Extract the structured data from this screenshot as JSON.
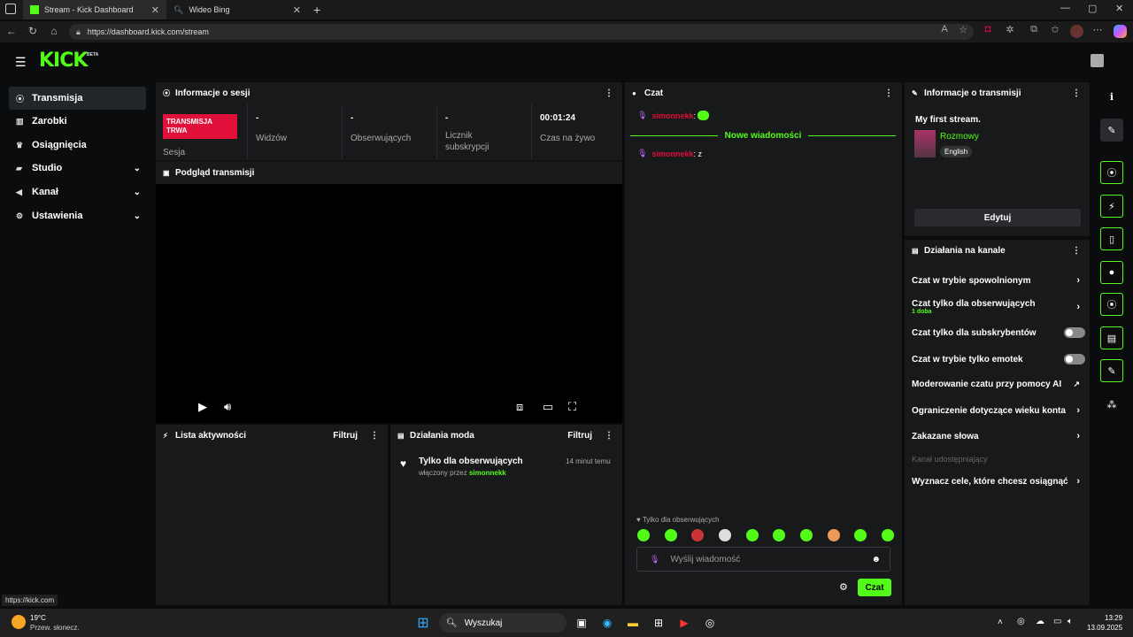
{
  "browser": {
    "tabs": [
      {
        "title": "Stream - Kick Dashboard"
      },
      {
        "title": "Wideo Bing"
      }
    ],
    "url": "https://dashboard.kick.com/stream",
    "status_url": "https://kick.com"
  },
  "app": {
    "logo": "KICK",
    "badge": "BETA"
  },
  "sidebar": {
    "items": [
      {
        "label": "Transmisja"
      },
      {
        "label": "Zarobki"
      },
      {
        "label": "Osiągnięcia"
      },
      {
        "label": "Studio"
      },
      {
        "label": "Kanał"
      },
      {
        "label": "Ustawienia"
      }
    ]
  },
  "session": {
    "title": "Informacje o sesji",
    "live_badge": "TRANSMISJA TRWA",
    "live_label": "Sesja",
    "stats": [
      {
        "value": "-",
        "label": "Widzów"
      },
      {
        "value": "-",
        "label": "Obserwujących"
      },
      {
        "value": "-",
        "label": "Licznik subskrypcji"
      },
      {
        "value": "00:01:24",
        "label": "Czas na żywo"
      }
    ]
  },
  "preview": {
    "title": "Podgląd transmisji"
  },
  "activity": {
    "title": "Lista aktywności",
    "filter": "Filtruj"
  },
  "mod": {
    "title": "Działania moda",
    "filter": "Filtruj",
    "entry": {
      "title": "Tylko dla obserwujących",
      "by_prefix": "włączony przez",
      "by_user": "simonnekk",
      "time": "14 minut temu"
    }
  },
  "chat": {
    "title": "Czat",
    "messages": [
      {
        "user": "simonnekk",
        "text": ""
      },
      {
        "user": "simonnekk",
        "text": "z"
      }
    ],
    "new_messages": "Nowe wiadomości",
    "mode_note": "Tylko dla obserwujących",
    "input_placeholder": "Wyślij wiadomość",
    "send_label": "Czat"
  },
  "stream_info": {
    "title": "Informacje o transmisji",
    "stream_title": "My first stream.",
    "category": "Rozmowy",
    "language": "English",
    "edit_label": "Edytuj"
  },
  "channel_actions": {
    "title": "Działania na kanale",
    "items": [
      {
        "label": "Czat w trybie spowolnionym"
      },
      {
        "label": "Czat tylko dla obserwujących",
        "sub": "1 doba"
      },
      {
        "label": "Czat tylko dla subskrybentów"
      },
      {
        "label": "Czat w trybie tylko emotek"
      },
      {
        "label": "Moderowanie czatu przy pomocy AI"
      },
      {
        "label": "Ograniczenie dotyczące wieku konta"
      },
      {
        "label": "Zakazane słowa"
      },
      {
        "label": "Kanał udostępniający"
      },
      {
        "label": "Wyznacz cele, które chcesz osiągnąć"
      }
    ]
  },
  "taskbar": {
    "weather_temp": "19°C",
    "weather_desc": "Przew. słonecz.",
    "search": "Wyszukaj",
    "time": "13:29",
    "date": "13.09.2025"
  },
  "colors": {
    "accent": "#53fc18",
    "live": "#e0103a",
    "panel": "#18191b"
  }
}
